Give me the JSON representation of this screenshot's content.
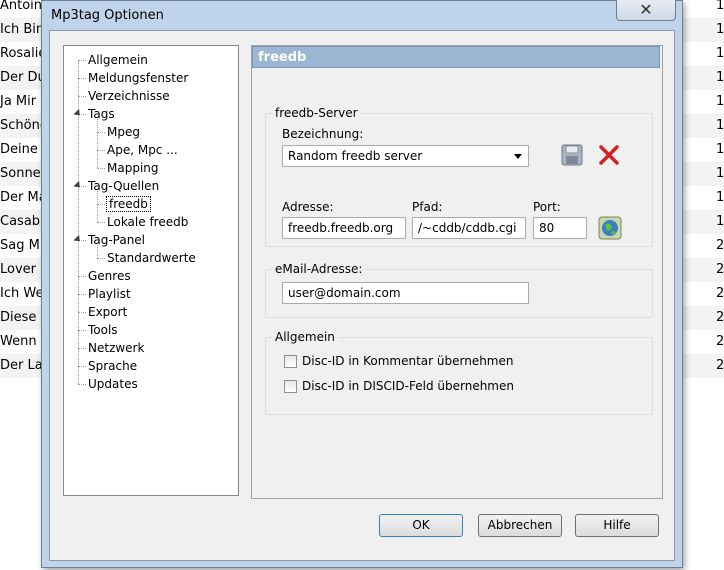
{
  "background_list": {
    "left_texts": [
      "Antoin",
      "Ich Bin",
      "Rosalie",
      "Der Du",
      "Ja Mir",
      "Schöne",
      "Deine",
      "Sonner",
      "Der Ma",
      "Casabl",
      "Sag Mi",
      "Lover M",
      "Ich We",
      "Diese I",
      "Wenn I",
      "Der La"
    ],
    "right_texts": [
      "1",
      "1",
      "1",
      "1",
      "1",
      "1",
      "1",
      "1",
      "1",
      "1",
      "2",
      "2",
      "2",
      "2",
      "2",
      "2"
    ]
  },
  "dialog": {
    "title": "Mp3tag Optionen",
    "close_glyph": "✕"
  },
  "tree": {
    "items": [
      {
        "label": "Allgemein",
        "level": 0
      },
      {
        "label": "Meldungsfenster",
        "level": 0
      },
      {
        "label": "Verzeichnisse",
        "level": 0
      },
      {
        "label": "Tags",
        "level": 0,
        "expanded": true
      },
      {
        "label": "Mpeg",
        "level": 1
      },
      {
        "label": "Ape, Mpc ...",
        "level": 1
      },
      {
        "label": "Mapping",
        "level": 1
      },
      {
        "label": "Tag-Quellen",
        "level": 0,
        "expanded": true
      },
      {
        "label": "freedb",
        "level": 1,
        "selected": true
      },
      {
        "label": "Lokale freedb",
        "level": 1
      },
      {
        "label": "Tag-Panel",
        "level": 0,
        "expanded": true
      },
      {
        "label": "Standardwerte",
        "level": 1
      },
      {
        "label": "Genres",
        "level": 0
      },
      {
        "label": "Playlist",
        "level": 0
      },
      {
        "label": "Export",
        "level": 0
      },
      {
        "label": "Tools",
        "level": 0
      },
      {
        "label": "Netzwerk",
        "level": 0
      },
      {
        "label": "Sprache",
        "level": 0
      },
      {
        "label": "Updates",
        "level": 0
      }
    ]
  },
  "panel": {
    "header": "freedb",
    "server_group": {
      "title": "freedb-Server",
      "bezeichnung_label": "Bezeichnung:",
      "bezeichnung_value": "Random freedb server",
      "adresse_label": "Adresse:",
      "adresse_value": "freedb.freedb.org",
      "pfad_label": "Pfad:",
      "pfad_value": "/~cddb/cddb.cgi",
      "port_label": "Port:",
      "port_value": "80"
    },
    "email_group": {
      "title": "eMail-Adresse:",
      "email_value": "user@domain.com"
    },
    "allgemein_group": {
      "title": "Allgemein",
      "check1_label": "Disc-ID in Kommentar übernehmen",
      "check2_label": "Disc-ID in DISCID-Feld übernehmen"
    }
  },
  "buttons": {
    "ok": "OK",
    "cancel": "Abbrechen",
    "help": "Hilfe"
  },
  "colors": {
    "header_bg": "#9bb6d3",
    "dialog_frame": "#bfd3ea"
  }
}
